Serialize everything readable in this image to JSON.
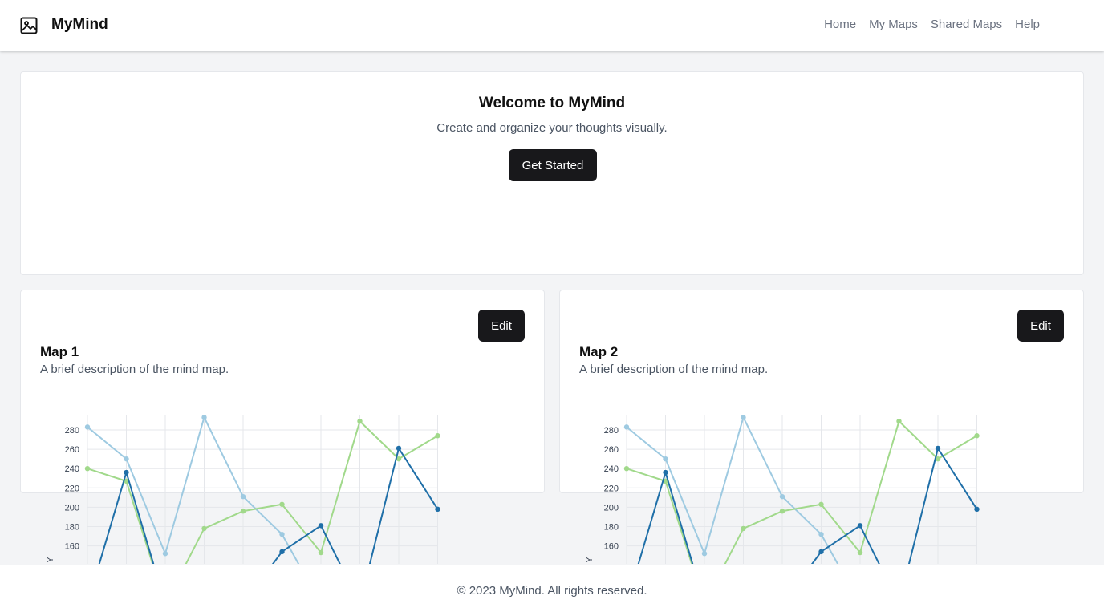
{
  "app": {
    "brand": "MyMind",
    "logo_icon": "image-icon"
  },
  "nav": {
    "items": [
      {
        "label": "Home"
      },
      {
        "label": "My Maps"
      },
      {
        "label": "Shared Maps"
      },
      {
        "label": "Help"
      }
    ]
  },
  "hero": {
    "title": "Welcome to MyMind",
    "subtitle": "Create and organize your thoughts visually.",
    "cta_label": "Get Started"
  },
  "cards": [
    {
      "title": "Map 1",
      "description": "A brief description of the mind map.",
      "edit_label": "Edit"
    },
    {
      "title": "Map 2",
      "description": "A brief description of the mind map.",
      "edit_label": "Edit"
    }
  ],
  "footer": {
    "text": "© 2023 MyMind. All rights reserved."
  },
  "colors": {
    "primary_button": "#18181b",
    "series_light_blue": "#9ecae1",
    "series_green": "#a1d98b",
    "series_dark_blue": "#1f6fa8"
  },
  "chart_data": [
    {
      "type": "line",
      "ylabel": "Y",
      "yticks": [
        160,
        180,
        200,
        220,
        240,
        260,
        280
      ],
      "x": [
        0,
        1,
        2,
        3,
        4,
        5,
        6,
        7,
        8,
        9
      ],
      "series": [
        {
          "color": "#9ecae1",
          "values": [
            283,
            250,
            152,
            293,
            211,
            172,
            100,
            100,
            100,
            100
          ]
        },
        {
          "color": "#a1d98b",
          "values": [
            240,
            227,
            100,
            178,
            196,
            203,
            153,
            289,
            250,
            274
          ]
        },
        {
          "color": "#1f6fa8",
          "values": [
            100,
            236,
            100,
            100,
            100,
            154,
            181,
            100,
            261,
            198
          ]
        }
      ]
    },
    {
      "type": "line",
      "ylabel": "Y",
      "yticks": [
        160,
        180,
        200,
        220,
        240,
        260,
        280
      ],
      "x": [
        0,
        1,
        2,
        3,
        4,
        5,
        6,
        7,
        8,
        9
      ],
      "series": [
        {
          "color": "#9ecae1",
          "values": [
            283,
            250,
            152,
            293,
            211,
            172,
            100,
            100,
            100,
            100
          ]
        },
        {
          "color": "#a1d98b",
          "values": [
            240,
            227,
            100,
            178,
            196,
            203,
            153,
            289,
            250,
            274
          ]
        },
        {
          "color": "#1f6fa8",
          "values": [
            100,
            236,
            100,
            100,
            100,
            154,
            181,
            100,
            261,
            198
          ]
        }
      ]
    }
  ]
}
